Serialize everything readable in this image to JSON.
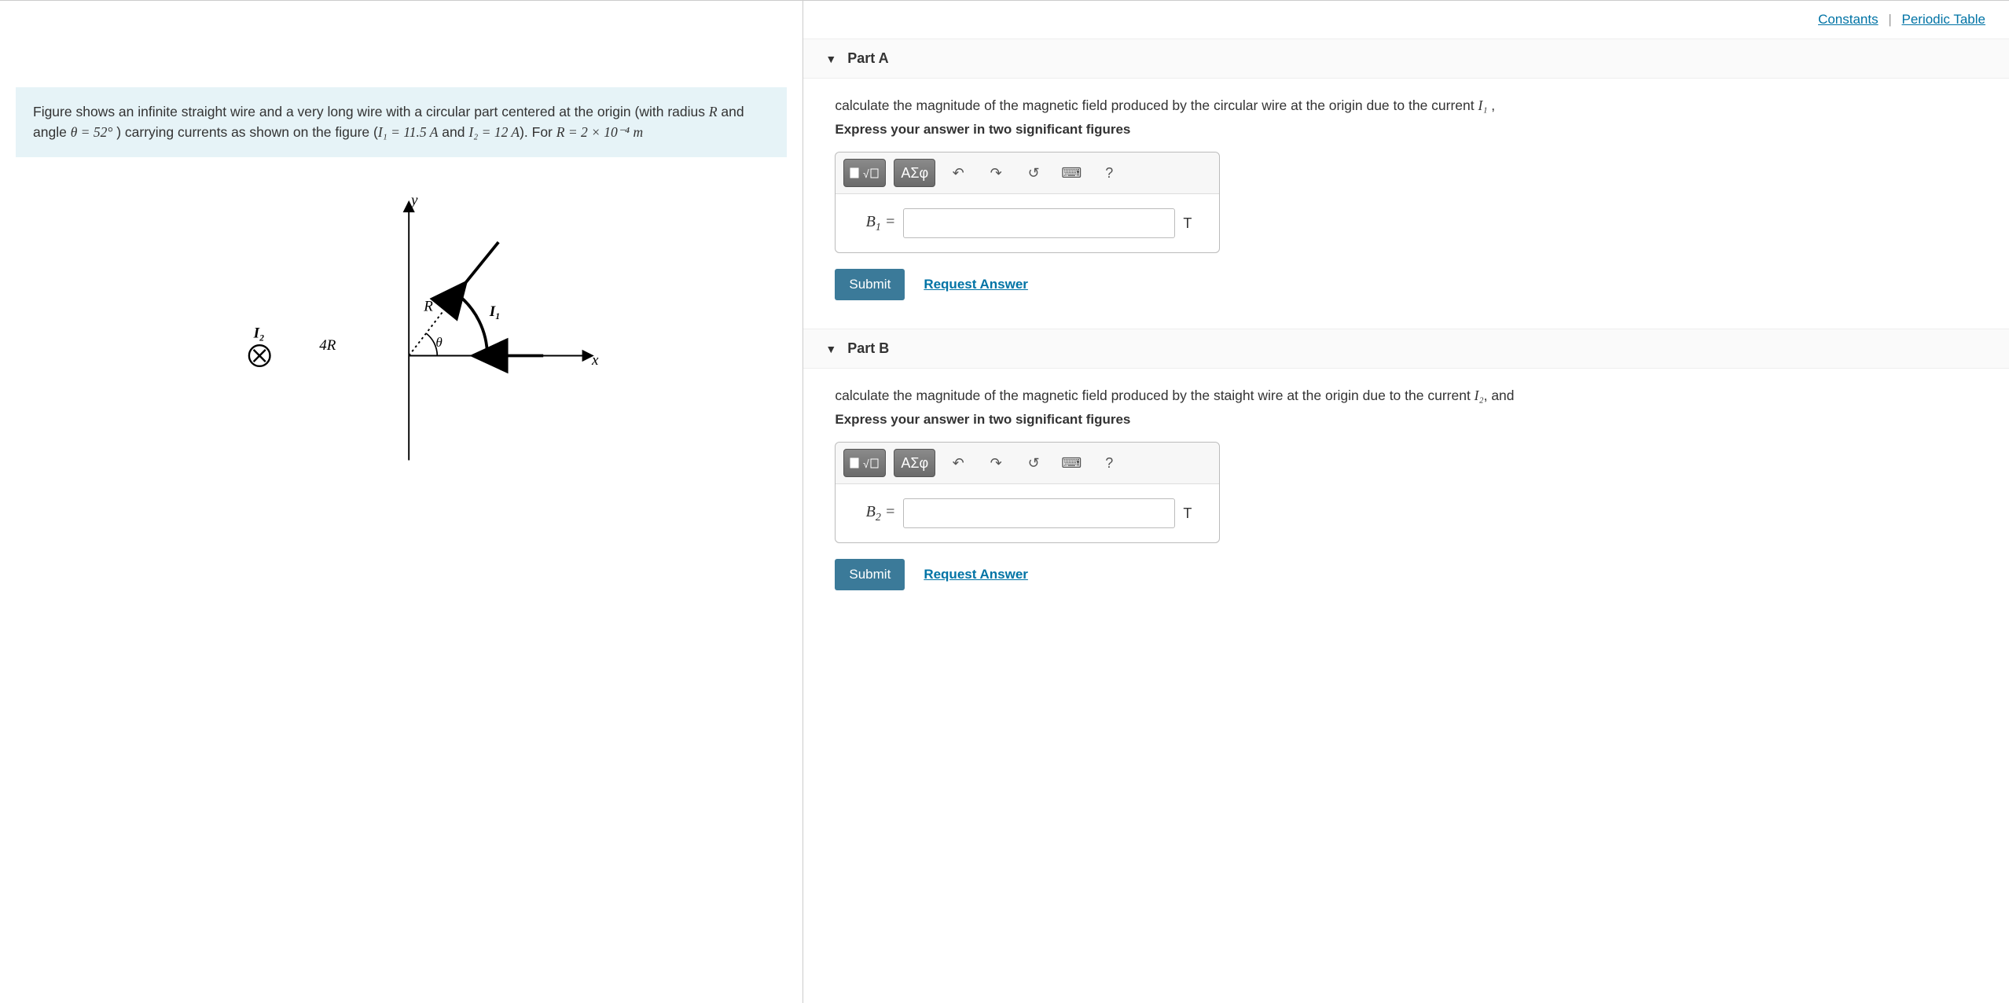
{
  "header_links": {
    "constants": "Constants",
    "periodic": "Periodic Table"
  },
  "problem": {
    "prefix": "Figure shows an infinite straight wire and a very long wire with a circular part centered at the origin  (with radius ",
    "R": "R",
    "and_angle": " and angle ",
    "theta_eq": "θ = 52°",
    "mid": " ) carrying currents as shown on the figure (",
    "I1": "I₁ = 11.5 A",
    "and": "  and ",
    "I2": "I₂ = 12 A",
    "for": "). For ",
    "Req": "R = 2 × 10⁻⁴ m"
  },
  "figure": {
    "y": "y",
    "x": "x",
    "R": "R",
    "theta": "θ",
    "I1": "I₁",
    "I2": "I₂",
    "fourR": "4R"
  },
  "partA": {
    "title": "Part A",
    "prompt_pre": "calculate the magnitude of the magnetic field produced by the circular wire at the origin due to the current ",
    "prompt_var": "I₁",
    "prompt_post": " ,",
    "instruction": "Express your answer in two significant figures",
    "label_var": "B",
    "label_sub": "1",
    "label_eq": " =",
    "unit": "T",
    "submit": "Submit",
    "request": "Request Answer"
  },
  "partB": {
    "title": "Part B",
    "prompt_pre": "calculate the magnitude of the magnetic field produced by the staight wire at the origin due to the current ",
    "prompt_var": "I₂",
    "prompt_post": ", and",
    "instruction": "Express your answer in two significant figures",
    "label_var": "B",
    "label_sub": "2",
    "label_eq": " =",
    "unit": "T",
    "submit": "Submit",
    "request": "Request Answer"
  },
  "toolbar": {
    "greek": "ΑΣφ",
    "help": "?"
  }
}
